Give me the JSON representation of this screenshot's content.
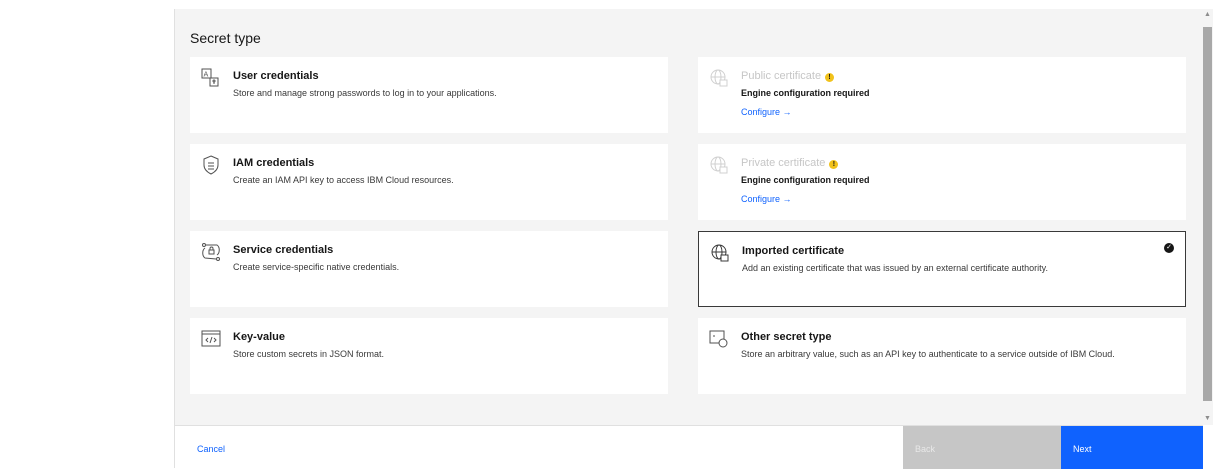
{
  "section_title": "Secret type",
  "tiles": [
    {
      "title": "User credentials",
      "desc": "Store and manage strong passwords to log in to your applications.",
      "icon": "user-credentials-icon"
    },
    {
      "title": "IAM credentials",
      "desc": "Create an IAM API key to access IBM Cloud resources.",
      "icon": "iam-credentials-icon"
    },
    {
      "title": "Service credentials",
      "desc": "Create service-specific native credentials.",
      "icon": "service-credentials-icon"
    },
    {
      "title": "Key-value",
      "desc": "Store custom secrets in JSON format.",
      "icon": "code-icon"
    },
    {
      "title": "Public certificate",
      "status": "Engine configuration required",
      "link": "Configure →",
      "icon": "globe-certificate-icon",
      "disabled": true
    },
    {
      "title": "Private certificate",
      "status": "Engine configuration required",
      "link": "Configure →",
      "icon": "globe-certificate-icon",
      "disabled": true
    },
    {
      "title": "Imported certificate",
      "desc": "Add an existing certificate that was issued by an external certificate authority.",
      "icon": "globe-certificate-icon",
      "selected": true
    },
    {
      "title": "Other secret type",
      "desc": "Store an arbitrary value, such as an API key to authenticate to a service outside of IBM Cloud.",
      "icon": "other-secret-icon"
    }
  ],
  "footer": {
    "cancel": "Cancel",
    "back": "Back",
    "next": "Next"
  },
  "scrollbar": {
    "up_glyph": "▲",
    "down_glyph": "▼"
  },
  "warning_glyph": "!",
  "check_glyph": "✓",
  "colors": {
    "accent": "#0f62fe",
    "warning": "#f1c21b",
    "disabled": "#c6c6c6"
  }
}
